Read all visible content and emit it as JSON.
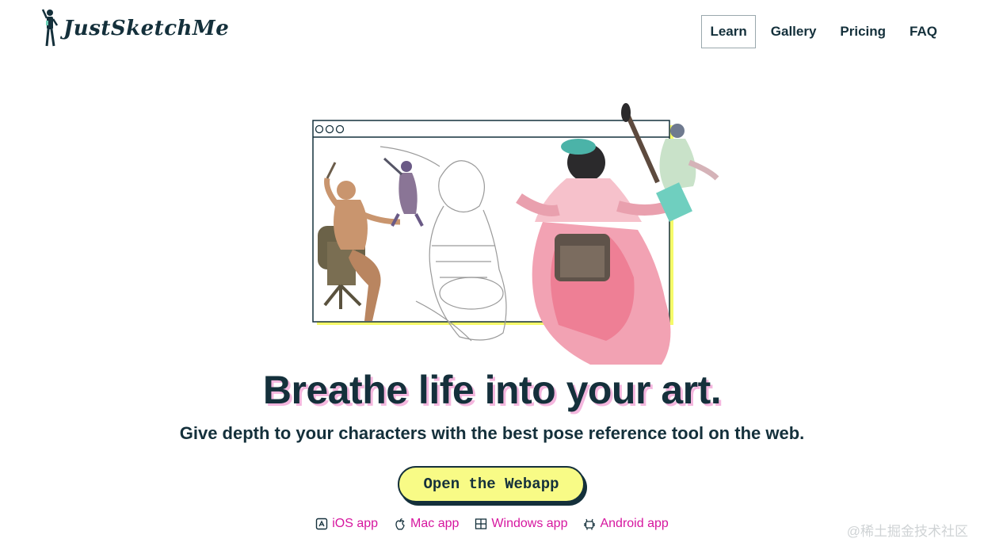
{
  "header": {
    "logo_text": "JustSketchMe",
    "nav": [
      {
        "label": "Learn",
        "active": true
      },
      {
        "label": "Gallery",
        "active": false
      },
      {
        "label": "Pricing",
        "active": false
      },
      {
        "label": "FAQ",
        "active": false
      }
    ]
  },
  "hero": {
    "headline": "Breathe life into your art.",
    "subheadline": "Give depth to your characters with the best pose reference tool on the web.",
    "cta_label": "Open the Webapp",
    "apps": [
      {
        "label": "iOS app",
        "icon": "app-store-icon"
      },
      {
        "label": "Mac app",
        "icon": "apple-icon"
      },
      {
        "label": "Windows app",
        "icon": "windows-icon"
      },
      {
        "label": "Android app",
        "icon": "android-icon"
      }
    ]
  },
  "watermark": "@稀土掘金技术社区",
  "colors": {
    "text": "#14303b",
    "cta_bg": "#f8fb86",
    "link": "#d6169f",
    "shadow_pink": "#f4b6de",
    "frame_highlight": "#f6fb6a"
  }
}
